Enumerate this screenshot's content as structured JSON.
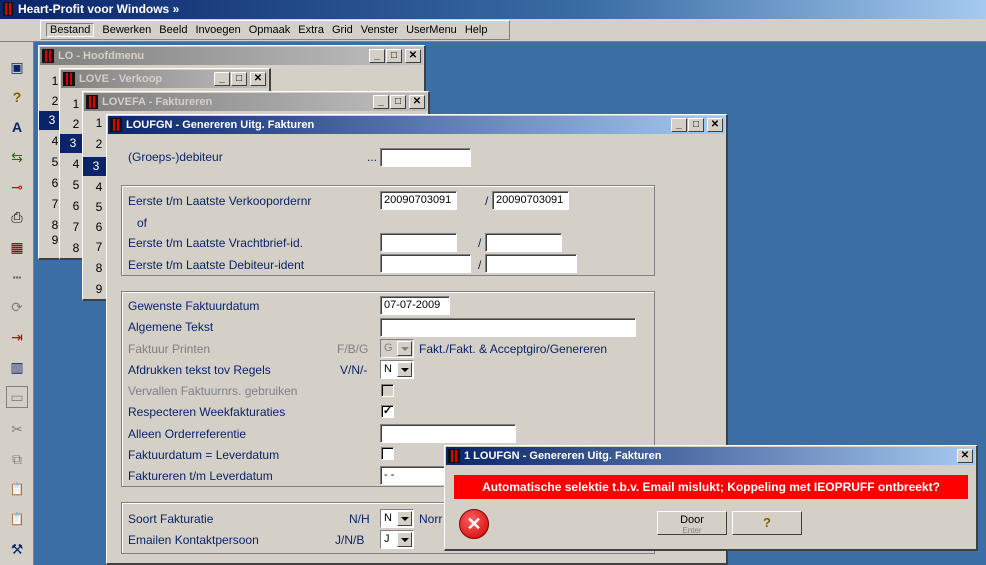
{
  "app": {
    "title": "Heart-Profit voor Windows  »"
  },
  "menu": [
    {
      "label": "Bestand"
    },
    {
      "label": "Bewerken"
    },
    {
      "label": "Beeld"
    },
    {
      "label": "Invoegen"
    },
    {
      "label": "Opmaak"
    },
    {
      "label": "Extra"
    },
    {
      "label": "Grid"
    },
    {
      "label": "Venster"
    },
    {
      "label": "UserMenu"
    },
    {
      "label": "Help"
    }
  ],
  "toolbar": {
    "icons": [
      "document-icon",
      "help-icon",
      "font-icon",
      "reload-icon",
      "key-icon",
      "print-icon",
      "calculator-icon",
      "dots-icon",
      "refresh-icon",
      "export-icon",
      "chart-icon",
      "window-icon",
      "cut-icon",
      "copy-icon",
      "paste-icon",
      "paste-special-icon",
      "tool-icon"
    ],
    "glyphs": [
      "▣",
      "?",
      "A",
      "⇆",
      "⊸",
      "⎙",
      "▦",
      "▪▪▪",
      "⟳",
      "⇥",
      "▥",
      "▭",
      "✂",
      "⧉",
      "📋",
      "📋",
      "⚒"
    ]
  },
  "windows": {
    "lo": {
      "title": "LO - Hoofdmenu",
      "rows": [
        "1",
        "2",
        "3",
        "4",
        "5",
        "6",
        "7",
        "8",
        "9"
      ],
      "selected_row": "3"
    },
    "love": {
      "title": "LOVE - Verkoop",
      "rows": [
        "1",
        "2",
        "3",
        "4",
        "5",
        "6",
        "7",
        "8"
      ],
      "selected_row": "3"
    },
    "lovefa": {
      "title": "LOVEFA - Faktureren",
      "rows": [
        "1",
        "2",
        "3",
        "4",
        "5",
        "6",
        "7",
        "8",
        "9"
      ],
      "selected_row": "3"
    },
    "loufgn": {
      "title": "LOUFGN - Genereren Uitg. Fakturen",
      "debiteur": {
        "label": "(Groeps-)debiteur",
        "dots": "...",
        "value": ""
      },
      "verkooporder": {
        "label": "Eerste t/m Laatste Verkoopordernr",
        "from": "20090703091",
        "slash": "/",
        "to": "20090703091"
      },
      "of": "of",
      "vrachtbrief": {
        "label": "Eerste t/m Laatste Vrachtbrief-id.",
        "from": "",
        "slash": "/",
        "to": ""
      },
      "debiteur_ident": {
        "label": "Eerste t/m Laatste Debiteur-ident",
        "from": "",
        "slash": "/",
        "to": ""
      },
      "faktuurdatum": {
        "label": "Gewenste Faktuurdatum",
        "value": "07-07-2009"
      },
      "algemene_tekst": {
        "label": "Algemene Tekst",
        "value": ""
      },
      "faktuur_printen": {
        "label": "Faktuur Printen",
        "code": "F/B/G",
        "value": "G",
        "description": "Fakt./Fakt. & Acceptgiro/Genereren"
      },
      "afdrukken": {
        "label": "Afdrukken tekst tov Regels",
        "code": "V/N/-",
        "value": "N"
      },
      "vervallen": {
        "label": "Vervallen Faktuurnrs. gebruiken",
        "checked": ""
      },
      "weekfakturaties": {
        "label": "Respecteren Weekfakturaties",
        "checked": "✓"
      },
      "orderreferentie": {
        "label": "Alleen Orderreferentie",
        "value": ""
      },
      "leverdatum_eq": {
        "label": "Faktuurdatum = Leverdatum",
        "checked": ""
      },
      "leverdatum_tm": {
        "label": "Faktureren t/m Leverdatum",
        "value": "- -"
      },
      "soort": {
        "label": "Soort Fakturatie",
        "code": "N/H",
        "value": "N",
        "description": "Norr"
      },
      "emailen": {
        "label": "Emailen Kontaktpersoon",
        "code": "J/N/B",
        "value": "J"
      }
    }
  },
  "dialog": {
    "title": "1 LOUFGN - Genereren Uitg. Fakturen",
    "close": "✕",
    "message": "Automatische selektie t.b.v. Email mislukt; Koppeling met IEOPRUFF ontbreekt?",
    "error_glyph": "✕",
    "ok_label": "Door",
    "ok_sub": "Enter",
    "help_glyph": "?"
  },
  "colors": {
    "desktop": "#3a6ea5",
    "error": "#ff0000",
    "label": "#0a246a"
  }
}
